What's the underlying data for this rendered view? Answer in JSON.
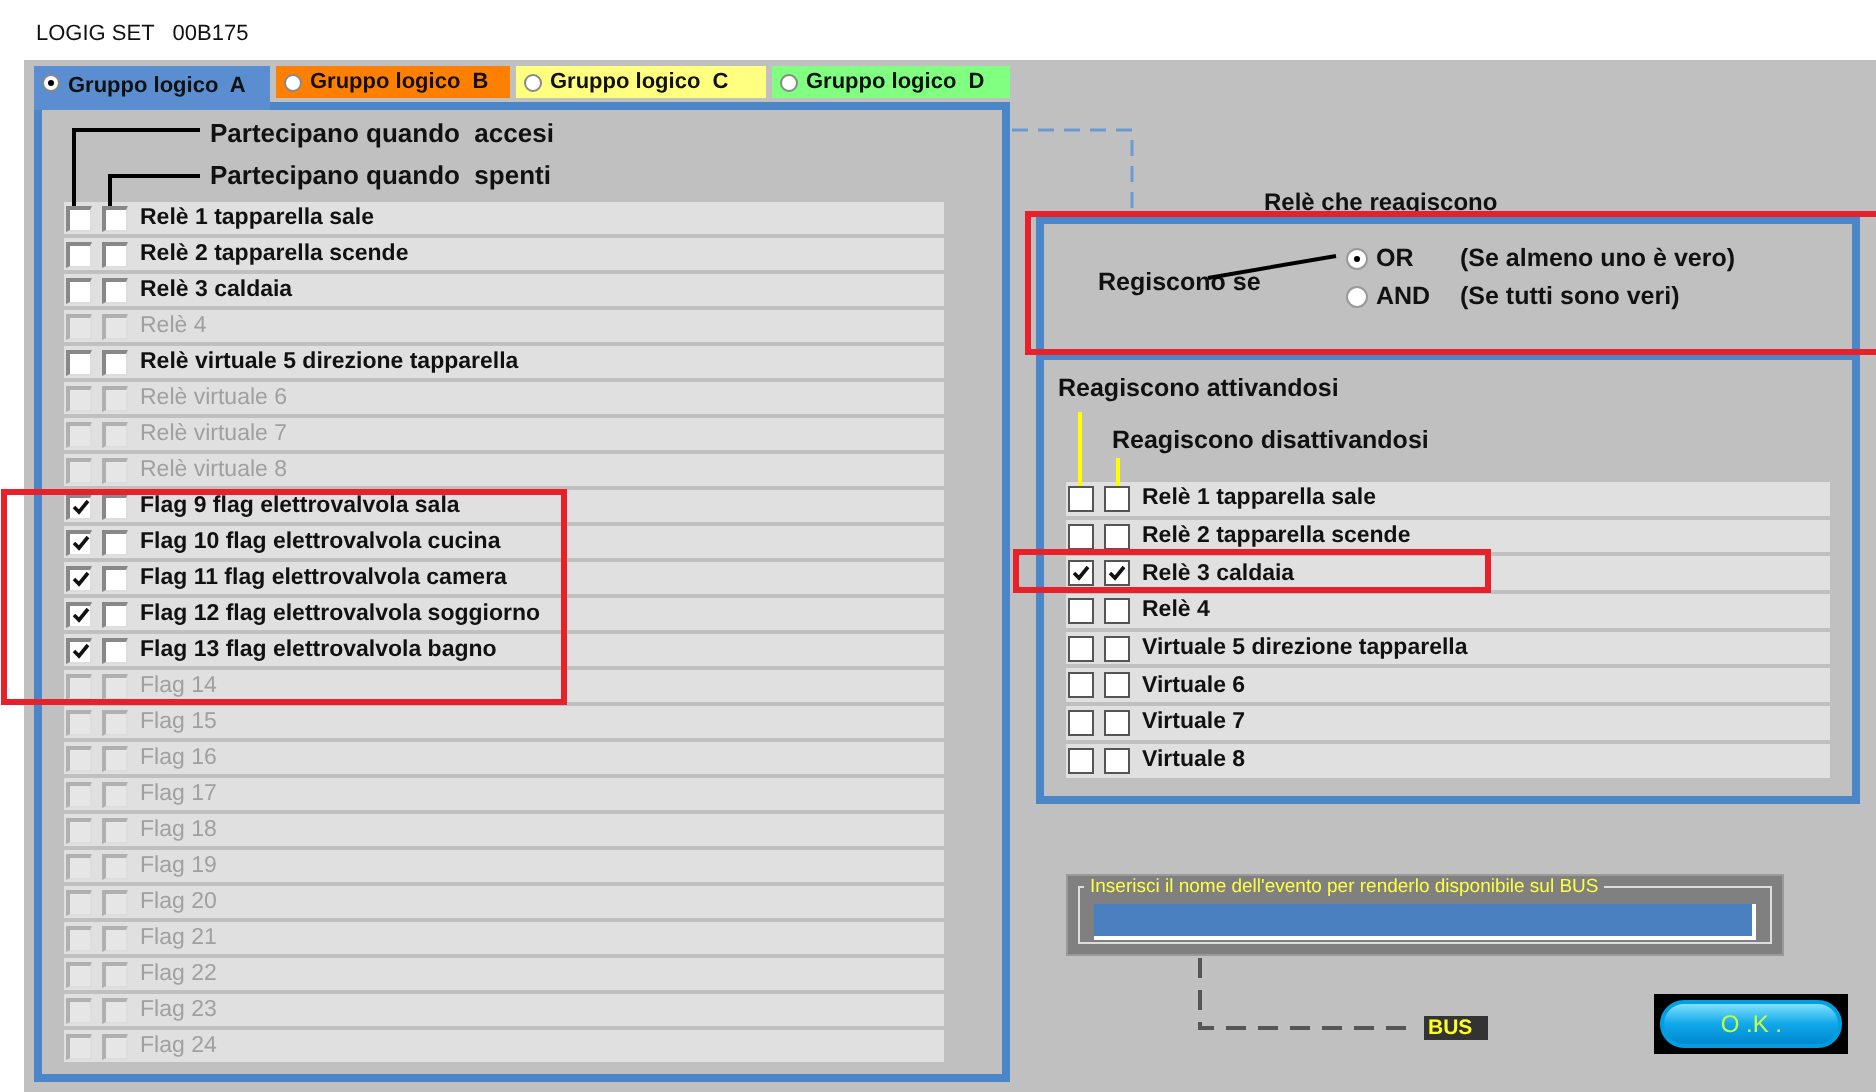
{
  "window": {
    "title": "LOGIG SET   00B175"
  },
  "tabs": [
    {
      "label": "Gruppo logico  A",
      "selected": true,
      "color": "#5a8ed0"
    },
    {
      "label": "Gruppo logico  B",
      "selected": false,
      "color": "#ff8000"
    },
    {
      "label": "Gruppo logico  C",
      "selected": false,
      "color": "#ffff80"
    },
    {
      "label": "Gruppo logico  D",
      "selected": false,
      "color": "#80ff80"
    }
  ],
  "left_panel": {
    "header_on": "Partecipano quando  accesi",
    "header_off": "Partecipano quando  spenti",
    "items": [
      {
        "label": "Relè 1 tapparella sale",
        "on": false,
        "off": false,
        "disabled": false
      },
      {
        "label": "Relè 2 tapparella scende",
        "on": false,
        "off": false,
        "disabled": false
      },
      {
        "label": "Relè 3 caldaia",
        "on": false,
        "off": false,
        "disabled": false
      },
      {
        "label": "Relè 4",
        "on": false,
        "off": false,
        "disabled": true
      },
      {
        "label": "Relè virtuale 5 direzione tapparella",
        "on": false,
        "off": false,
        "disabled": false
      },
      {
        "label": "Relè virtuale 6",
        "on": false,
        "off": false,
        "disabled": true
      },
      {
        "label": "Relè virtuale 7",
        "on": false,
        "off": false,
        "disabled": true
      },
      {
        "label": "Relè virtuale 8",
        "on": false,
        "off": false,
        "disabled": true
      },
      {
        "label": "Flag 9 flag elettrovalvola sala",
        "on": true,
        "off": false,
        "disabled": false
      },
      {
        "label": "Flag 10 flag elettrovalvola cucina",
        "on": true,
        "off": false,
        "disabled": false
      },
      {
        "label": "Flag 11 flag elettrovalvola camera",
        "on": true,
        "off": false,
        "disabled": false
      },
      {
        "label": "Flag 12 flag elettrovalvola soggiorno",
        "on": true,
        "off": false,
        "disabled": false
      },
      {
        "label": "Flag 13 flag elettrovalvola bagno",
        "on": true,
        "off": false,
        "disabled": false
      },
      {
        "label": "Flag 14",
        "on": false,
        "off": false,
        "disabled": true
      },
      {
        "label": "Flag 15",
        "on": false,
        "off": false,
        "disabled": true
      },
      {
        "label": "Flag 16",
        "on": false,
        "off": false,
        "disabled": true
      },
      {
        "label": "Flag 17",
        "on": false,
        "off": false,
        "disabled": true
      },
      {
        "label": "Flag 18",
        "on": false,
        "off": false,
        "disabled": true
      },
      {
        "label": "Flag 19",
        "on": false,
        "off": false,
        "disabled": true
      },
      {
        "label": "Flag 20",
        "on": false,
        "off": false,
        "disabled": true
      },
      {
        "label": "Flag 21",
        "on": false,
        "off": false,
        "disabled": true
      },
      {
        "label": "Flag 22",
        "on": false,
        "off": false,
        "disabled": true
      },
      {
        "label": "Flag 23",
        "on": false,
        "off": false,
        "disabled": true
      },
      {
        "label": "Flag 24",
        "on": false,
        "off": false,
        "disabled": true
      }
    ]
  },
  "right_panel": {
    "title": "Relè che reagiscono",
    "condition_label": "Regiscono se",
    "options": [
      {
        "label": "OR",
        "description": "(Se almeno uno è vero)",
        "selected": true
      },
      {
        "label": "AND",
        "description": "(Se tutti sono veri)",
        "selected": false
      }
    ],
    "header_on": "Reagiscono attivandosi",
    "header_off": "Reagiscono disattivandosi",
    "items": [
      {
        "label": "Relè 1 tapparella sale",
        "on": false,
        "off": false
      },
      {
        "label": "Relè 2 tapparella scende",
        "on": false,
        "off": false
      },
      {
        "label": "Relè 3 caldaia",
        "on": true,
        "off": true
      },
      {
        "label": "Relè 4",
        "on": false,
        "off": false
      },
      {
        "label": "Virtuale 5 direzione tapparella",
        "on": false,
        "off": false
      },
      {
        "label": "Virtuale 6",
        "on": false,
        "off": false
      },
      {
        "label": "Virtuale 7",
        "on": false,
        "off": false
      },
      {
        "label": "Virtuale 8",
        "on": false,
        "off": false
      }
    ]
  },
  "event_field": {
    "label": "Inserisci il nome dell'evento per renderlo disponibile sul BUS"
  },
  "bus_label": "BUS",
  "ok_button": "O .K ."
}
